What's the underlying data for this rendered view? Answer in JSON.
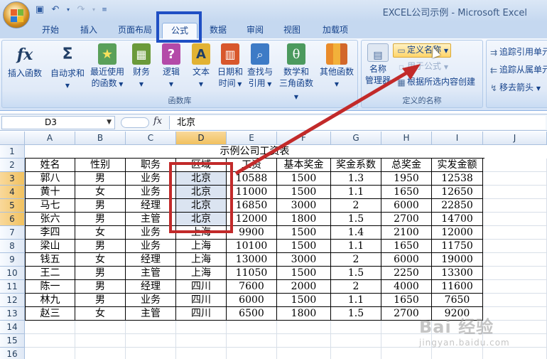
{
  "window": {
    "title": "EXCEL公司示例 - Microsoft Excel"
  },
  "tabs": [
    "开始",
    "插入",
    "页面布局",
    "公式",
    "数据",
    "审阅",
    "视图",
    "加载项"
  ],
  "active_tab": "公式",
  "ribbon": {
    "function_library": {
      "label": "函数库",
      "insert_function": "插入函数",
      "autosum": "自动求和",
      "recent_line1": "最近使用",
      "recent_line2": "的函数",
      "financial": "财务",
      "logical": "逻辑",
      "text": "文本",
      "datetime_line1": "日期和",
      "datetime_line2": "时间",
      "lookup_line1": "查找与",
      "lookup_line2": "引用",
      "math_line1": "数学和",
      "math_line2": "三角函数",
      "more": "其他函数"
    },
    "defined_names": {
      "label": "定义的名称",
      "name_manager_line1": "名称",
      "name_manager_line2": "管理器",
      "define_name": "定义名称",
      "use_in_formula": "用于公式",
      "create_from_selection": "根据所选内容创建"
    },
    "formula_auditing": {
      "trace_precedents": "追踪引用单元",
      "trace_dependents": "追踪从属单元",
      "remove_arrows": "移去箭头"
    }
  },
  "formula_bar": {
    "name_box": "D3",
    "fx": "fx",
    "content": "北京"
  },
  "sheet": {
    "columns": [
      "A",
      "B",
      "C",
      "D",
      "E",
      "F",
      "G",
      "H",
      "I",
      "J"
    ],
    "selected_column": "D",
    "rows": [
      "1",
      "2",
      "3",
      "4",
      "5",
      "6",
      "7",
      "8",
      "9",
      "10",
      "11",
      "12",
      "13",
      "14",
      "15",
      "16"
    ],
    "selected_rows": [
      "3",
      "4",
      "5",
      "6"
    ],
    "title": "示例公司工资表",
    "headers": [
      "姓名",
      "性别",
      "职务",
      "区域",
      "工资",
      "基本奖金",
      "奖金系数",
      "总奖金",
      "实发金额"
    ],
    "data": [
      [
        "郭八",
        "男",
        "业务",
        "北京",
        "10588",
        "1500",
        "1.3",
        "1950",
        "12538"
      ],
      [
        "黄十",
        "女",
        "业务",
        "北京",
        "11000",
        "1500",
        "1.1",
        "1650",
        "12650"
      ],
      [
        "马七",
        "男",
        "经理",
        "北京",
        "16850",
        "3000",
        "2",
        "6000",
        "22850"
      ],
      [
        "张六",
        "男",
        "主管",
        "北京",
        "12000",
        "1800",
        "1.5",
        "2700",
        "14700"
      ],
      [
        "李四",
        "女",
        "业务",
        "上海",
        "9900",
        "1500",
        "1.4",
        "2100",
        "12000"
      ],
      [
        "梁山",
        "男",
        "业务",
        "上海",
        "10100",
        "1500",
        "1.1",
        "1650",
        "11750"
      ],
      [
        "钱五",
        "女",
        "经理",
        "上海",
        "13000",
        "3000",
        "2",
        "6000",
        "19000"
      ],
      [
        "王二",
        "男",
        "主管",
        "上海",
        "11050",
        "1500",
        "1.5",
        "2250",
        "13300"
      ],
      [
        "陈一",
        "男",
        "经理",
        "四川",
        "7600",
        "2000",
        "2",
        "4000",
        "11600"
      ],
      [
        "林九",
        "男",
        "业务",
        "四川",
        "6000",
        "1500",
        "1.1",
        "1650",
        "7650"
      ],
      [
        "赵三",
        "女",
        "主管",
        "四川",
        "6500",
        "1800",
        "1.5",
        "2700",
        "9200"
      ]
    ]
  },
  "watermark": "Bai 经验",
  "watermark_sub": "jingyan.baidu.com"
}
